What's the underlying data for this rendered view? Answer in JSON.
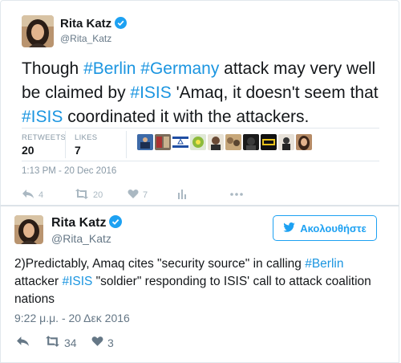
{
  "tweet1": {
    "author_name": "Rita Katz",
    "author_handle": "@Rita_Katz",
    "text_parts": {
      "p1": "Though ",
      "h1": "#Berlin",
      "p2": " ",
      "h2": "#Germany",
      "p3": " attack may very well be claimed by ",
      "h3": "#ISIS",
      "p4": " 'Amaq, it doesn't seem that ",
      "h4": "#ISIS",
      "p5": " coordinated it with the attackers."
    },
    "retweets_label": "RETWEETS",
    "retweets_value": "20",
    "likes_label": "LIKES",
    "likes_value": "7",
    "timestamp": "1:13 PM - 20 Dec 2016",
    "actions": {
      "reply_count": "4",
      "retweet_count": "20",
      "like_count": "7"
    }
  },
  "tweet2": {
    "author_name": "Rita Katz",
    "author_handle": "@Rita_Katz",
    "follow_label": "Ακολουθήστε",
    "text_parts": {
      "p1": "2)Predictably, Amaq cites \"security source\" in calling ",
      "h1": "#Berlin",
      "p2": " attacker ",
      "h2": "#ISIS",
      "p3": " \"soldier\" responding to ISIS' call to attack coalition nations"
    },
    "timestamp": "9:22 μ.μ. - 20 Δεκ 2016",
    "actions": {
      "retweet_count": "34",
      "like_count": "3"
    }
  },
  "colors": {
    "accent": "#1da1f2",
    "hashtag": "#1b95e0",
    "muted": "#8899a6",
    "border": "#e1e8ed"
  },
  "icons": [
    "verified-badge-icon",
    "reply-icon",
    "retweet-icon",
    "like-icon",
    "analytics-icon",
    "more-icon",
    "twitter-bird-icon"
  ]
}
